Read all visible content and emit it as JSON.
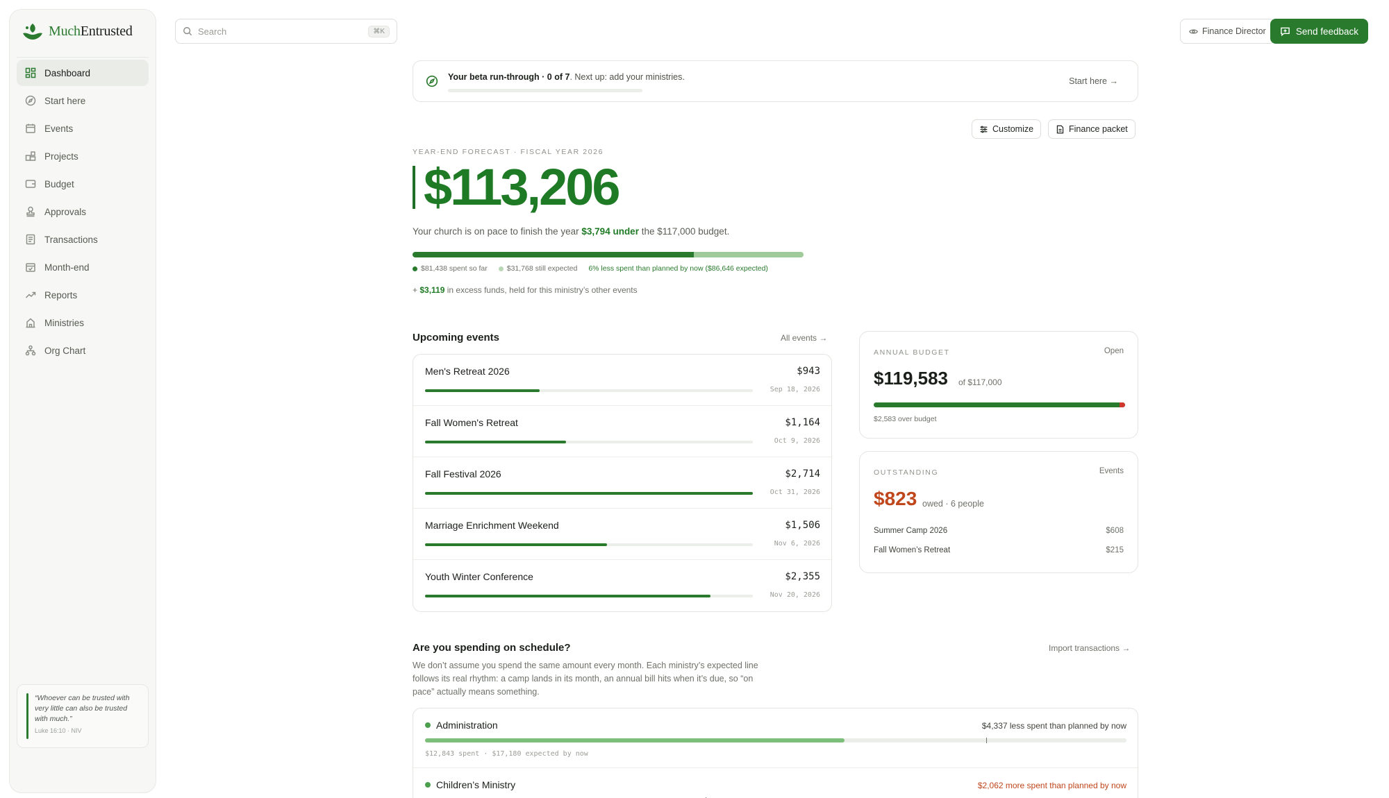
{
  "app": {
    "logo_prefix": "Much",
    "logo_suffix": "Entrusted",
    "search_placeholder": "Search",
    "search_shortcut": "⌘K"
  },
  "sidebar": {
    "items": [
      {
        "label": "Dashboard",
        "icon": "dashboard-icon",
        "active": true
      },
      {
        "label": "Start here",
        "icon": "compass-icon"
      },
      {
        "label": "Events",
        "icon": "calendar-icon"
      },
      {
        "label": "Projects",
        "icon": "projects-icon"
      },
      {
        "label": "Budget",
        "icon": "wallet-icon"
      },
      {
        "label": "Approvals",
        "icon": "stamp-icon"
      },
      {
        "label": "Transactions",
        "icon": "receipt-icon"
      },
      {
        "label": "Month-end",
        "icon": "calendar-check-icon"
      },
      {
        "label": "Reports",
        "icon": "trend-icon"
      },
      {
        "label": "Ministries",
        "icon": "building-icon"
      },
      {
        "label": "Org Chart",
        "icon": "org-chart-icon"
      }
    ],
    "quote": {
      "text": "“Whoever can be trusted with very little can also be trusted with much.”",
      "reference": "Luke 16:10 · NIV"
    }
  },
  "header": {
    "role_label": "Finance Director",
    "feedback_label": "Send feedback"
  },
  "beta": {
    "title": "Your beta run-through · 0 of 7",
    "next": ". Next up: add your ministries.",
    "progress": 0,
    "link": "Start here →"
  },
  "toolbar": {
    "customize": "Customize",
    "finance_packet": "Finance packet"
  },
  "forecast": {
    "eyebrow": "Year-end forecast · Fiscal year 2026",
    "value": "$113,206",
    "sub_prefix": "Your church is on pace to finish the year ",
    "sub_highlight": "$3,794 under",
    "sub_suffix": " the $117,000 budget.",
    "spent_fraction": 0.72,
    "expected_fraction": 0.28,
    "legend_spent": "$81,438 spent so far",
    "legend_expected": "$31,768 still expected",
    "legend_status": "6% less spent than planned by now ($86,646 expected)",
    "excess_prefix": "+ ",
    "excess_amount": "$3,119",
    "excess_suffix": " in excess funds, held for this ministry’s other events",
    "colors": {
      "spent": "#2a7a2e",
      "expected": "#9fcb9b"
    }
  },
  "events": {
    "title": "Upcoming events",
    "link": "All events →",
    "items": [
      {
        "name": "Men's Retreat 2026",
        "amount": "$943",
        "date": "Sep 18, 2026",
        "progress": 0.35
      },
      {
        "name": "Fall Women's Retreat",
        "amount": "$1,164",
        "date": "Oct 9, 2026",
        "progress": 0.43
      },
      {
        "name": "Fall Festival 2026",
        "amount": "$2,714",
        "date": "Oct 31, 2026",
        "progress": 1.0
      },
      {
        "name": "Marriage Enrichment Weekend",
        "amount": "$1,506",
        "date": "Nov 6, 2026",
        "progress": 0.555
      },
      {
        "name": "Youth Winter Conference",
        "amount": "$2,355",
        "date": "Nov 20, 2026",
        "progress": 0.87
      }
    ]
  },
  "annual_budget": {
    "eyebrow": "Annual budget",
    "tag": "Open",
    "value": "$119,583",
    "of": "of $117,000",
    "note": "$2,583 over budget"
  },
  "outstanding": {
    "eyebrow": "Outstanding",
    "tag": "Events",
    "value": "$823",
    "sub": "owed · 6 people",
    "rows": [
      {
        "name": "Summer Camp 2026",
        "amount": "$608"
      },
      {
        "name": "Fall Women’s Retreat",
        "amount": "$215"
      }
    ],
    "color": "#c0461c"
  },
  "spending": {
    "title": "Are you spending on schedule?",
    "link": "Import transactions →",
    "description": "We don’t assume you spend the same amount every month. Each ministry’s expected line follows its real rhythm: a camp lands in its month, an annual bill hits when it’s due, so “on pace” actually means something.",
    "items": [
      {
        "name": "Administration",
        "status": "$4,337 less spent than planned by now",
        "status_color": "#3e423b",
        "fill": 0.598,
        "marker": 0.8,
        "fill_color": "#7dbf7a",
        "meta": "$12,843 spent · $17,180 expected by now"
      },
      {
        "name": "Children’s Ministry",
        "status": "$2,062 more spent than planned by now",
        "status_color": "#c0461c",
        "fill": 0.755,
        "marker": 0.4,
        "fill_color": "#4aa04c",
        "meta": ""
      }
    ]
  }
}
